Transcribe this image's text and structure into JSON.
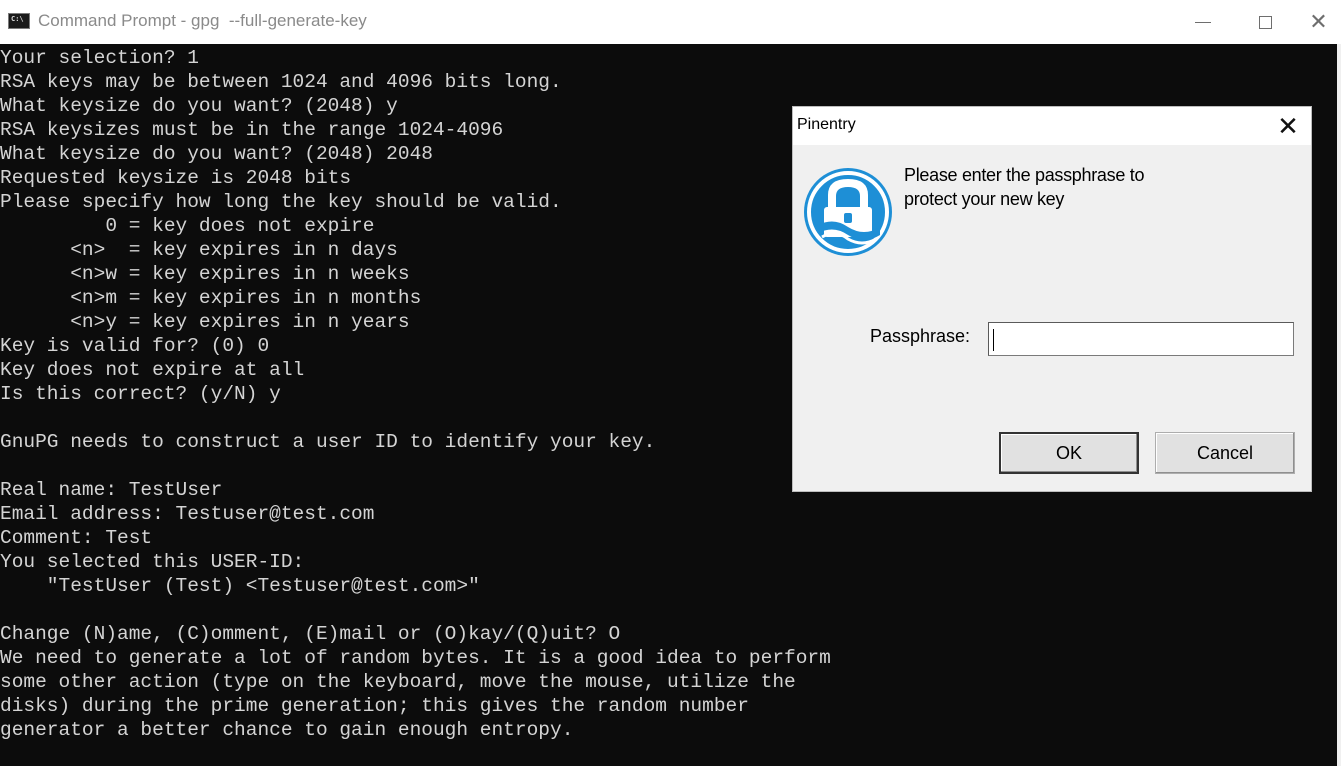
{
  "window": {
    "title": "Command Prompt - gpg  --full-generate-key",
    "icon_glyph": "C:\\",
    "controls": {
      "minimize": "",
      "maximize": "",
      "close": "✕"
    }
  },
  "console": {
    "lines": [
      "Your selection? 1",
      "RSA keys may be between 1024 and 4096 bits long.",
      "What keysize do you want? (2048) y",
      "RSA keysizes must be in the range 1024-4096",
      "What keysize do you want? (2048) 2048",
      "Requested keysize is 2048 bits",
      "Please specify how long the key should be valid.",
      "         0 = key does not expire",
      "      <n>  = key expires in n days",
      "      <n>w = key expires in n weeks",
      "      <n>m = key expires in n months",
      "      <n>y = key expires in n years",
      "Key is valid for? (0) 0",
      "Key does not expire at all",
      "Is this correct? (y/N) y",
      "",
      "GnuPG needs to construct a user ID to identify your key.",
      "",
      "Real name: TestUser",
      "Email address: Testuser@test.com",
      "Comment: Test",
      "You selected this USER-ID:",
      "    \"TestUser (Test) <Testuser@test.com>\"",
      "",
      "Change (N)ame, (C)omment, (E)mail or (O)kay/(Q)uit? O",
      "We need to generate a lot of random bytes. It is a good idea to perform",
      "some other action (type on the keyboard, move the mouse, utilize the",
      "disks) during the prime generation; this gives the random number",
      "generator a better chance to gain enough entropy."
    ]
  },
  "dialog": {
    "title": "Pinentry",
    "close_label": "✕",
    "icon": "lock-icon",
    "message_line1": "Please enter the passphrase to",
    "message_line2": "protect your new key",
    "passphrase_label": "Passphrase:",
    "passphrase_value": "",
    "ok_label": "OK",
    "cancel_label": "Cancel"
  },
  "colors": {
    "console_bg": "#0c0c0c",
    "console_fg": "#d4d4d4",
    "dialog_bg": "#f0f0f0",
    "lock_icon_blue": "#1e8fd6"
  }
}
